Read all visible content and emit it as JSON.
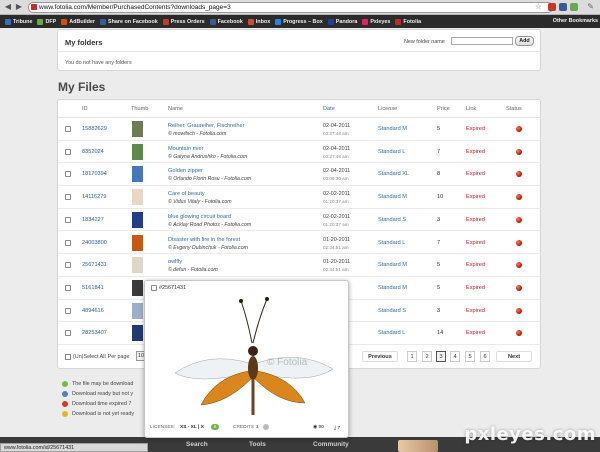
{
  "browser": {
    "url": "www.fotolia.com/Member/PurchasedContents?downloads_page=3",
    "bookmarks": [
      {
        "label": "Tribune",
        "color": "#3b6fb5"
      },
      {
        "label": "DFP",
        "color": "#6aa84f"
      },
      {
        "label": "AdBuilder",
        "color": "#d35400"
      },
      {
        "label": "Share on Facebook",
        "color": "#3b5998"
      },
      {
        "label": "Press Orders",
        "color": "#c0392b"
      },
      {
        "label": "Facebook",
        "color": "#3b5998"
      },
      {
        "label": "Inbox",
        "color": "#d44638"
      },
      {
        "label": "Progress – Box",
        "color": "#1e88e5"
      },
      {
        "label": "Pandora",
        "color": "#224099"
      },
      {
        "label": "Pxleyes",
        "color": "#e91e63"
      },
      {
        "label": "Fotolia",
        "color": "#c62828"
      }
    ],
    "other_bookmarks": "Other Bookmarks",
    "status_url": "www.fotolia.com/id/25671431"
  },
  "folders": {
    "title": "My folders",
    "new_folder_label": "New folder name",
    "new_folder_value": "",
    "add_label": "Add",
    "empty_text": "You do not have any folders"
  },
  "myfiles": {
    "title": "My Files",
    "headers": {
      "id": "ID",
      "thumb": "Thumb",
      "name": "Name",
      "date": "Date",
      "license": "License",
      "price": "Price",
      "link": "Link",
      "status": "Status"
    },
    "rows": [
      {
        "id": "15882629",
        "title": "Reiher, Graureiher, Fischreiher",
        "author": "© mowitsch - Fotolia.com",
        "date": "02-04-2011",
        "time": "03:27:48 am",
        "license": "Standard M",
        "price": "5",
        "link": "Expired",
        "thumb_color": "#6b7d52"
      },
      {
        "id": "8352024",
        "title": "Mountain river",
        "author": "© Galyna Andrushko - Fotolia.com",
        "date": "02-04-2011",
        "time": "03:27:48 am",
        "license": "Standard L",
        "price": "7",
        "link": "Expired",
        "thumb_color": "#5a8a4a"
      },
      {
        "id": "18170394",
        "title": "Golden zipper",
        "author": "© Orlando Florin Rosu - Fotolia.com",
        "date": "02-04-2011",
        "time": "03:06:30 am",
        "license": "Standard XL",
        "price": "8",
        "link": "Expired",
        "thumb_color": "#4477bb"
      },
      {
        "id": "14116279",
        "title": "Care of beauty",
        "author": "© Vidus Vitaly - Fotolia.com",
        "date": "02-02-2011",
        "time": "01:20:37 am",
        "license": "Standard M",
        "price": "10",
        "link": "Expired",
        "thumb_color": "#e8d8c4"
      },
      {
        "id": "1834227",
        "title": "blue glowing circuit board",
        "author": "© Acklay Road Photos - Fotolia.com",
        "date": "02-02-2011",
        "time": "01:20:37 am",
        "license": "Standard S",
        "price": "3",
        "link": "Expired",
        "thumb_color": "#1f3f8a"
      },
      {
        "id": "24003800",
        "title": "Disaster with fire in the forest",
        "author": "© Evgeny Dubinchuk - Fotolia.com",
        "date": "01-20-2011",
        "time": "02:34:51 am",
        "license": "Standard L",
        "price": "7",
        "link": "Expired",
        "thumb_color": "#c65a12"
      },
      {
        "id": "25671431",
        "title": "owlfly",
        "author": "© defun - Fotolia.com",
        "date": "01-20-2011",
        "time": "02:34:51 am",
        "license": "Standard M",
        "price": "5",
        "link": "Expired",
        "thumb_color": "#e0d6c8"
      },
      {
        "id": "5161841",
        "title": "",
        "author": "",
        "date": "",
        "time": "",
        "license": "Standard M",
        "price": "5",
        "link": "Expired",
        "thumb_color": "#3a3a3a"
      },
      {
        "id": "4894616",
        "title": "",
        "author": "",
        "date": "",
        "time": "",
        "license": "Standard S",
        "price": "3",
        "link": "Expired",
        "thumb_color": "#9ab0c8"
      },
      {
        "id": "28253407",
        "title": "",
        "author": "",
        "date": "",
        "time": "",
        "license": "Standard L",
        "price": "14",
        "link": "Expired",
        "thumb_color": "#203a70"
      }
    ],
    "select_all": "(Un)Select All",
    "per_page_label": "Per page",
    "per_page_value": "10",
    "pager": {
      "prev": "Previous",
      "pages": [
        "1",
        "2",
        "3",
        "4",
        "5",
        "6"
      ],
      "current": "3",
      "next": "Next"
    }
  },
  "legend": [
    {
      "text": "The file may be download",
      "color": "#6cc04a"
    },
    {
      "text": "Download ready but not y",
      "color": "#4a7fd4"
    },
    {
      "text": "Download time expired 7",
      "color": "#d63a1e"
    },
    {
      "text": "Download is not yet ready",
      "color": "#e5b620"
    }
  ],
  "popup": {
    "id_label": "#25671431",
    "watermark": "© Fotolia",
    "licenses_label": "LICENSES:",
    "licenses_value": "XS - XL | X",
    "licenses_badge": "S",
    "credits_label": "CREDITS :",
    "credits_value": "1",
    "views": "90",
    "downloads": "7"
  },
  "footer": {
    "items": [
      "Search",
      "Tools",
      "Community"
    ]
  },
  "watermark": "pxleyes.com"
}
